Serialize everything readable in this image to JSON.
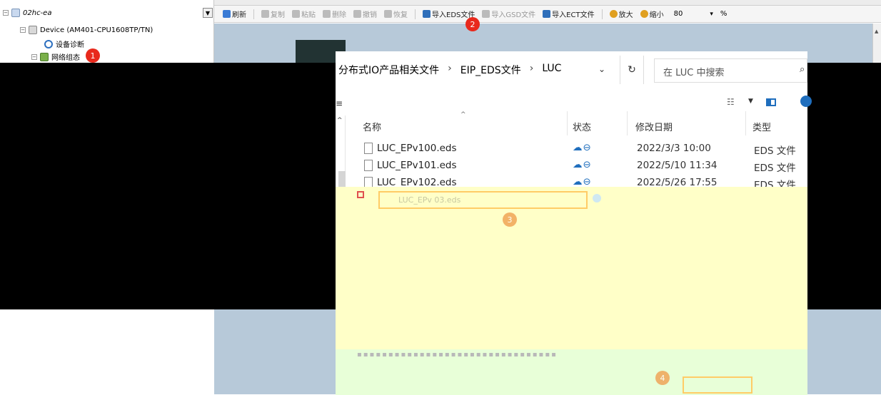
{
  "tree": {
    "project": "02hc-ea",
    "device": "Device (AM401-CPU1608TP/TN)",
    "diagnostics": "设备诊断",
    "network": "网络组态"
  },
  "toolbar": {
    "refresh": "刷新",
    "copy": "复制",
    "paste": "粘贴",
    "delete": "删除",
    "undo": "撤销",
    "redo": "恢复",
    "import_eds": "导入EDS文件",
    "import_gsd": "导入GSD文件",
    "import_ect": "导入ECT文件",
    "zoom_in": "放大",
    "zoom_out": "缩小",
    "zoom_value": "80",
    "zoom_unit": "%"
  },
  "callouts": [
    "1",
    "2",
    "3",
    "4"
  ],
  "dialog": {
    "breadcrumb": [
      "分布式IO产品相关文件",
      "EIP_EDS文件",
      "LUC"
    ],
    "search_placeholder": "在 LUC 中搜索",
    "columns": {
      "name": "名称",
      "status": "状态",
      "date": "修改日期",
      "type": "类型"
    },
    "files": [
      {
        "name": "LUC_EPv100.eds",
        "status": "☁⊖",
        "date": "2022/3/3 10:00",
        "type": "EDS 文件"
      },
      {
        "name": "LUC_EPv101.eds",
        "status": "☁⊖",
        "date": "2022/5/10 11:34",
        "type": "EDS 文件"
      },
      {
        "name": "LUC_EPv102.eds",
        "status": "☁⊖",
        "date": "2022/5/26 17:55",
        "type": "EDS 文件"
      }
    ],
    "filename_value": "LUC_EPv 03.eds"
  },
  "colors": {
    "callout": "#e8291c",
    "workarea": "#b7c9d9",
    "yellow_band": "#ffffc8",
    "green_band": "#e8ffd8",
    "accent": "#1f6ebd"
  }
}
